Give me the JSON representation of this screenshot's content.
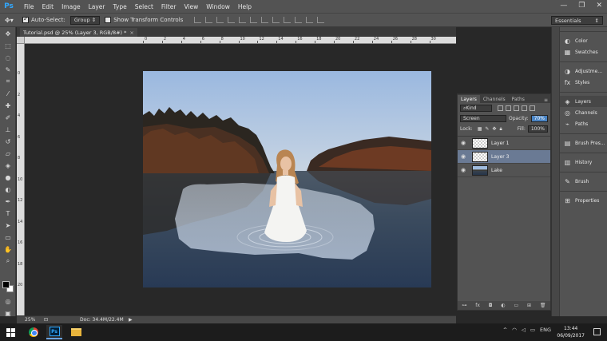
{
  "app": {
    "logo": "Ps"
  },
  "menu": [
    "File",
    "Edit",
    "Image",
    "Layer",
    "Type",
    "Select",
    "Filter",
    "View",
    "Window",
    "Help"
  ],
  "window_controls": {
    "minimize": "—",
    "maximize": "❐",
    "close": "✕"
  },
  "options": {
    "auto_select_label": "Auto-Select:",
    "auto_select_checked": true,
    "auto_select_target": "Group",
    "transform_label": "Show Transform Controls",
    "transform_checked": false,
    "workspace": "Essentials"
  },
  "document": {
    "tab_title": "Tutorial.psd @ 25% (Layer 3, RGB/8#) *",
    "close_icon": "×",
    "zoom": "25%",
    "doc_size": "Doc: 34.4M/22.4M"
  },
  "ruler_top": [
    "0",
    "2",
    "4",
    "6",
    "8",
    "10",
    "12",
    "14",
    "16",
    "18",
    "20",
    "22",
    "24",
    "26",
    "28",
    "30"
  ],
  "ruler_left": [
    "0",
    "2",
    "4",
    "6",
    "8",
    "10",
    "12",
    "14",
    "16",
    "18",
    "20"
  ],
  "dock": [
    {
      "label": "Color",
      "icon": "color-icon"
    },
    {
      "label": "Swatches",
      "icon": "swatches-icon"
    },
    {
      "label": "Adjustme...",
      "icon": "adjustments-icon"
    },
    {
      "label": "Styles",
      "icon": "styles-icon"
    },
    {
      "label": "Layers",
      "icon": "layers-icon"
    },
    {
      "label": "Channels",
      "icon": "channels-icon"
    },
    {
      "label": "Paths",
      "icon": "paths-icon"
    },
    {
      "label": "Brush Pres...",
      "icon": "brush-presets-icon"
    },
    {
      "label": "History",
      "icon": "history-icon"
    },
    {
      "label": "Brush",
      "icon": "brush-icon"
    },
    {
      "label": "Properties",
      "icon": "properties-icon"
    }
  ],
  "layers_panel": {
    "tabs": [
      "Layers",
      "Channels",
      "Paths"
    ],
    "filter_kind": "Kind",
    "blend_mode": "Screen",
    "opacity_label": "Opacity:",
    "opacity": "70%",
    "lock_label": "Lock:",
    "fill_label": "Fill:",
    "fill": "100%",
    "layers": [
      {
        "name": "Layer 1",
        "selected": false,
        "thumb": "checker"
      },
      {
        "name": "Layer 3",
        "selected": true,
        "thumb": "checker"
      },
      {
        "name": "Lake",
        "selected": false,
        "thumb": "lake"
      }
    ]
  },
  "taskbar": {
    "tray_lang": "ENG",
    "time": "13:44",
    "date": "06/09/2017"
  }
}
